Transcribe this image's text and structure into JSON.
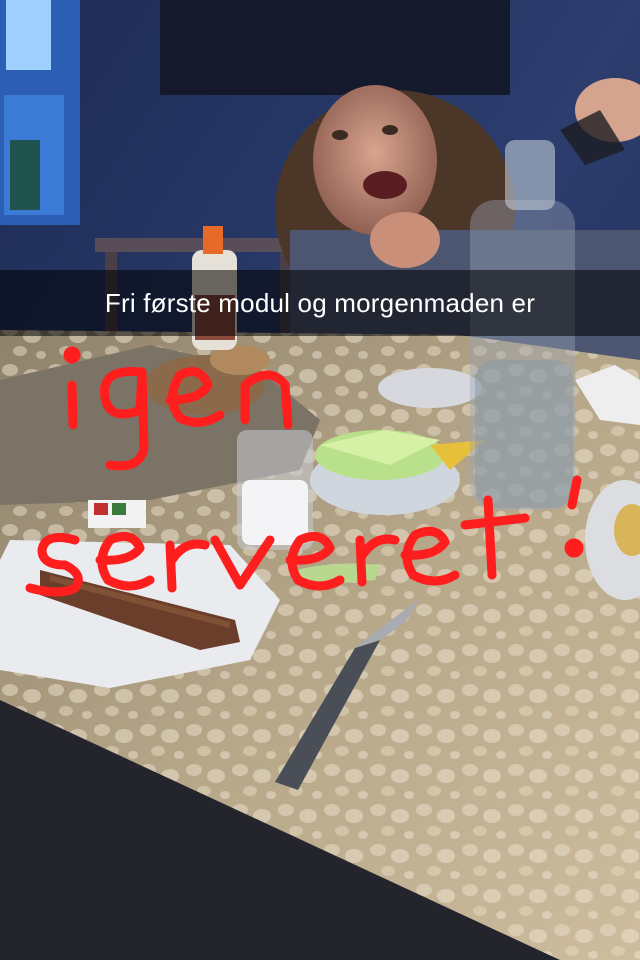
{
  "caption": {
    "text": "Fri første modul og morgenmaden er"
  },
  "drawing": {
    "color": "#ff1e1e",
    "line1": "igen",
    "line2": "serveret",
    "punctuation": "!"
  },
  "scene": {
    "wall_color": "#2a3a66",
    "table_color": "#b9a98c",
    "window_color": "#4aa0ff"
  }
}
